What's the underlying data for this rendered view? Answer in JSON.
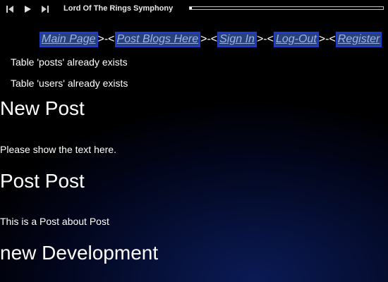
{
  "player": {
    "buttons": [
      "previous-icon",
      "play-icon",
      "next-icon"
    ],
    "track_title": "Lord Of The Rings Symphony",
    "progress": 0.01
  },
  "nav": {
    "items": [
      "Main Page",
      "Post Blogs Here",
      "Sign In",
      "Log-Out",
      "Register"
    ],
    "separator": ">-<"
  },
  "messages": [
    "Table 'posts' already exists",
    "Table 'users' already exists"
  ],
  "posts": [
    {
      "title": "New Post",
      "body": "Please show the text here."
    },
    {
      "title": "Post Post",
      "body": "This is a Post about Post"
    },
    {
      "title": "new Development",
      "body": ""
    }
  ],
  "colors": {
    "link_border": "#1b3ad6",
    "link_bg": "#2a4078",
    "link_text": "#9bb5e8",
    "background": "#000000",
    "glow": "#0a1a55"
  }
}
